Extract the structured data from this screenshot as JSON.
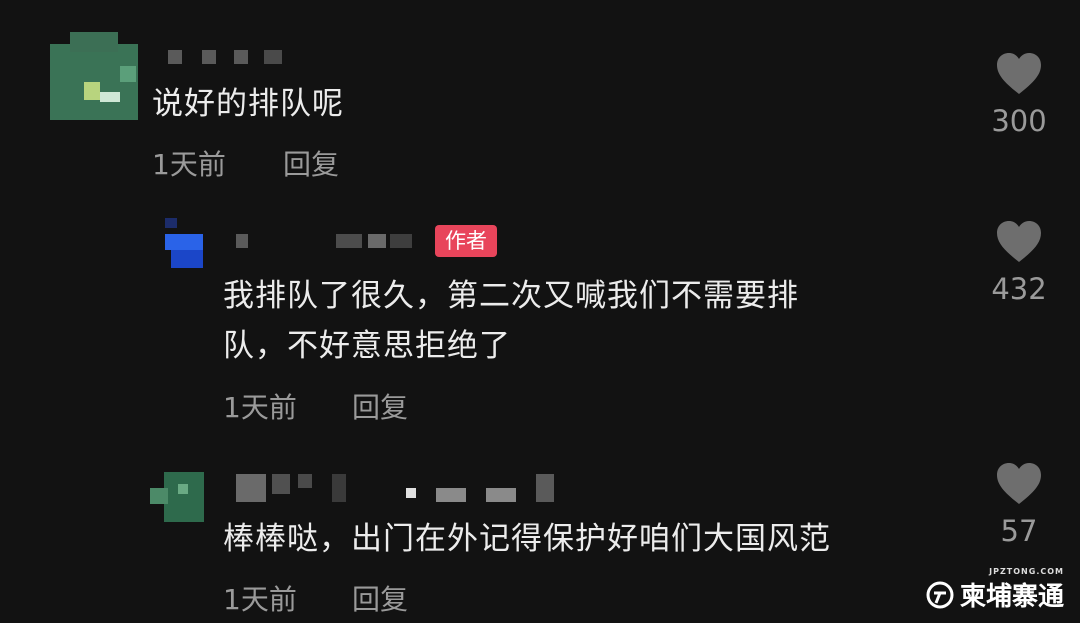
{
  "comments": [
    {
      "text": "说好的排队呢",
      "time": "1天前",
      "reply_label": "回复",
      "likes": "300"
    },
    {
      "badge": "作者",
      "text_line1": "我排队了很久，第二次又喊我们不需要排",
      "text_line2": "队，不好意思拒绝了",
      "time": "1天前",
      "reply_label": "回复",
      "likes": "432"
    },
    {
      "text": "棒棒哒，出门在外记得保护好咱们大国风范",
      "time": "1天前",
      "reply_label": "回复",
      "likes": "57"
    }
  ],
  "watermark": {
    "url_text": "JPZTONG.COM",
    "brand": "柬埔寨通"
  },
  "colors": {
    "background": "#121212",
    "author_badge": "#e8455b",
    "heart": "#6e6e6e"
  }
}
